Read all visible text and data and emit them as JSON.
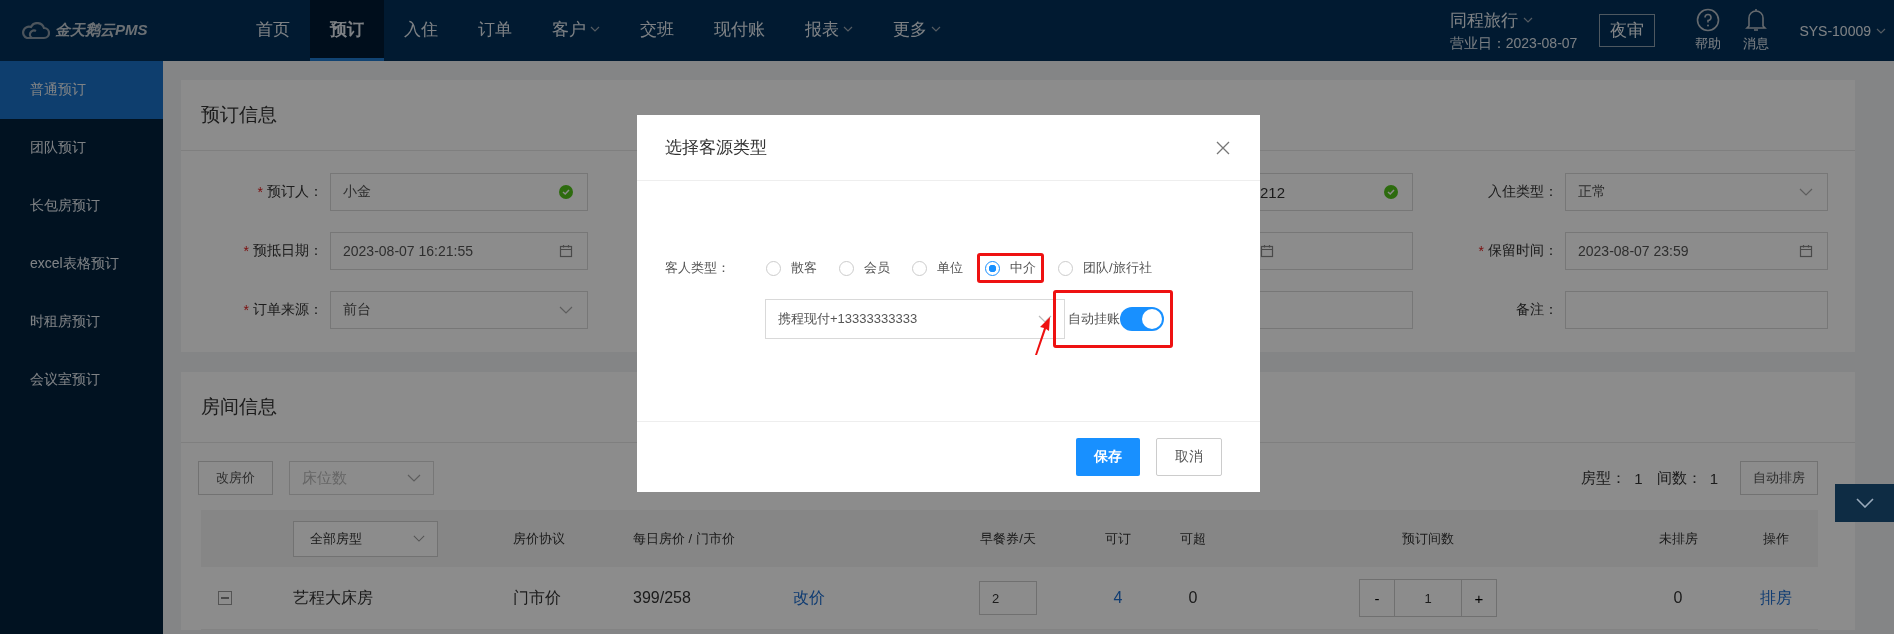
{
  "app": {
    "logo": "金天鹅云PMS"
  },
  "nav": [
    {
      "label": "首页",
      "selected": false,
      "dropdown": false
    },
    {
      "label": "预订",
      "selected": true,
      "dropdown": false
    },
    {
      "label": "入住",
      "selected": false,
      "dropdown": false
    },
    {
      "label": "订单",
      "selected": false,
      "dropdown": false
    },
    {
      "label": "客户",
      "selected": false,
      "dropdown": true
    },
    {
      "label": "交班",
      "selected": false,
      "dropdown": false
    },
    {
      "label": "现付账",
      "selected": false,
      "dropdown": false
    },
    {
      "label": "报表",
      "selected": false,
      "dropdown": true
    },
    {
      "label": "更多",
      "selected": false,
      "dropdown": true
    }
  ],
  "hotel": {
    "name": "同程旅行",
    "business_day": "营业日：2023-08-07"
  },
  "night_audit": "夜审",
  "tools": [
    {
      "label": "帮助",
      "kind": "help"
    },
    {
      "label": "消息",
      "kind": "bell"
    }
  ],
  "user": "SYS-10009",
  "sidebar": [
    {
      "label": "普通预订",
      "selected": true
    },
    {
      "label": "团队预订",
      "selected": false
    },
    {
      "label": "长包房预订",
      "selected": false
    },
    {
      "label": "excel表格预订",
      "selected": false
    },
    {
      "label": "时租房预订",
      "selected": false
    },
    {
      "label": "会议室预订",
      "selected": false
    }
  ],
  "booking_info": {
    "title": "预订信息",
    "rows": [
      [
        {
          "label": "预订人：",
          "required_mark": "*",
          "value": "小金",
          "kind": "valid"
        },
        {
          "value": "212",
          "kind": "valid"
        },
        {
          "label": "入住类型：",
          "value": "正常",
          "kind": "select"
        }
      ],
      [
        {
          "label": "预抵日期：",
          "required_mark": "*",
          "value": "2023-08-07 16:21:55",
          "kind": "date"
        },
        {
          "kind": "date"
        },
        {
          "label": "保留时间：",
          "required_mark": "*",
          "value": "2023-08-07 23:59",
          "kind": "date"
        }
      ],
      [
        {
          "label": "订单来源：",
          "required_mark": "*",
          "value": "前台",
          "kind": "select"
        },
        {
          "kind": "text"
        },
        {
          "label": "备注：",
          "kind": "text"
        }
      ]
    ]
  },
  "room_info": {
    "title": "房间信息",
    "change_price_button": "改房价",
    "bed_select": {
      "placeholder": "床位数"
    },
    "summary": [
      {
        "label": "房型：",
        "value": "1"
      },
      {
        "label": "间数：",
        "value": "1"
      }
    ],
    "auto_button": "自动排房",
    "room_type_select": "全部房型",
    "columns": [
      "房价协议",
      "每日房价 / 门市价",
      "早餐券/天",
      "可订",
      "可超",
      "预订间数",
      "未排房",
      "操作"
    ],
    "rows": [
      {
        "name": "艺程大床房",
        "agreement": "门市价",
        "price": "399/258",
        "change_price": "改价",
        "breakfast": "2",
        "available": "4",
        "overbook": "0",
        "decrement": "-",
        "quantity": "1",
        "increment": "+",
        "unassigned": "0",
        "action": "排房"
      }
    ]
  },
  "modal": {
    "title": "选择客源类型",
    "guest_type_label": "客人类型：",
    "options": [
      {
        "label": "散客",
        "selected": false,
        "highlighted": false
      },
      {
        "label": "会员",
        "selected": false,
        "highlighted": false
      },
      {
        "label": "单位",
        "selected": false,
        "highlighted": false
      },
      {
        "label": "中介",
        "selected": true,
        "highlighted": true
      },
      {
        "label": "团队/旅行社",
        "selected": false,
        "highlighted": false
      }
    ],
    "source_select": {
      "value": "携程现付+13333333333"
    },
    "auto_charge": {
      "label": "自动挂账",
      "on": true,
      "highlighted": true
    },
    "buttons": [
      {
        "label": "保存",
        "kind": "primary"
      },
      {
        "label": "取消",
        "kind": "default"
      }
    ]
  }
}
